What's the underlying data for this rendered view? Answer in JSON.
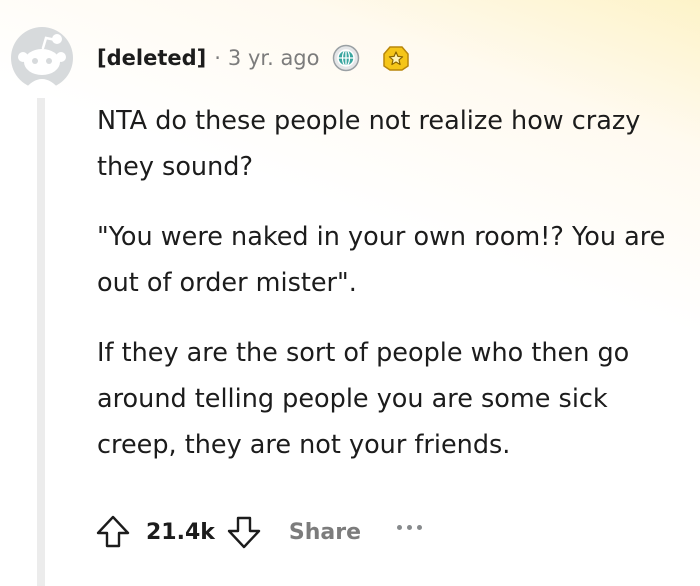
{
  "comment": {
    "author": "[deleted]",
    "separator": "·",
    "time": "3 yr. ago",
    "awards": [
      "globe-award-icon",
      "star-award-icon"
    ],
    "paragraphs": [
      "NTA do these people not realize how crazy they sound?",
      "\"You were naked in your own room!? You are out of order mister\".",
      "If they are the sort of people who then go around telling people you are some sick creep, they are not your friends."
    ],
    "actions": {
      "score": "21.4k",
      "share_label": "Share"
    }
  },
  "colors": {
    "text": "#1c1c1c",
    "muted": "#7c7c7c",
    "thread_line": "#ececec",
    "avatar": "#d7dadc",
    "award_gold": "#f5c518",
    "award_teal": "#3aa6a0"
  }
}
